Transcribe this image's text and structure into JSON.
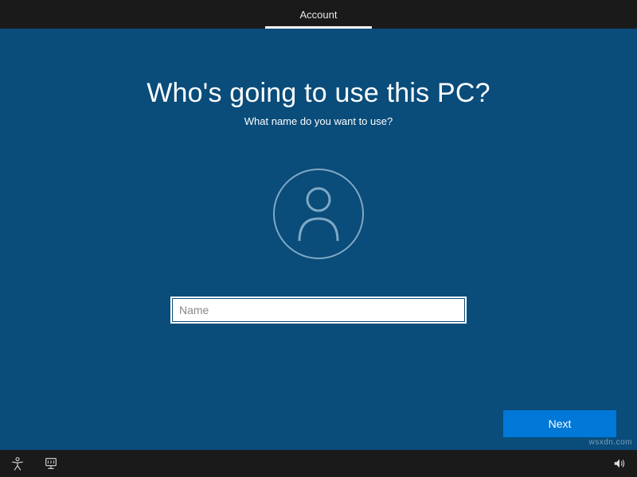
{
  "topbar": {
    "active_tab": "Account"
  },
  "main": {
    "title": "Who's going to use this PC?",
    "subtitle": "What name do you want to use?",
    "name_input": {
      "placeholder": "Name",
      "value": ""
    },
    "next_button": "Next"
  },
  "icons": {
    "ease_of_access": "ease-of-access",
    "input_method": "input-method",
    "volume": "volume"
  },
  "watermark": "wsxdn.com"
}
